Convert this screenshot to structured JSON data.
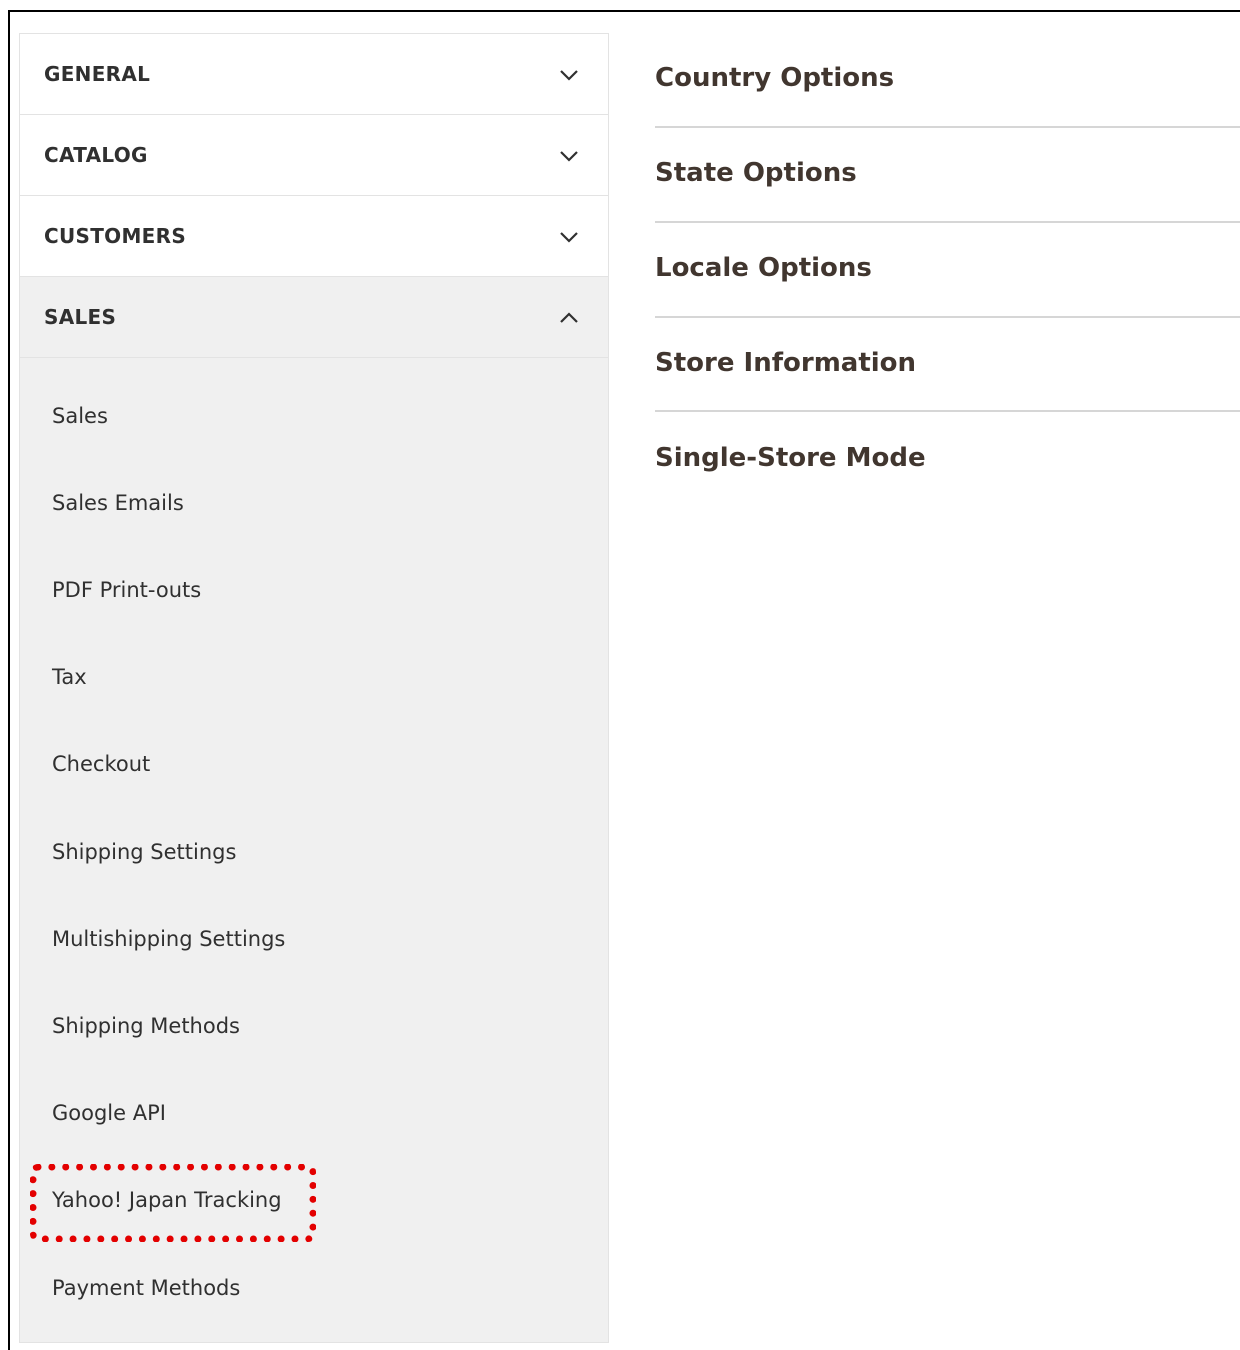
{
  "sidebar": {
    "sections": [
      {
        "label": "GENERAL",
        "state": "collapsed"
      },
      {
        "label": "CATALOG",
        "state": "collapsed"
      },
      {
        "label": "CUSTOMERS",
        "state": "collapsed"
      },
      {
        "label": "SALES",
        "state": "expanded"
      }
    ],
    "sales_items": [
      "Sales",
      "Sales Emails",
      "PDF Print-outs",
      "Tax",
      "Checkout",
      "Shipping Settings",
      "Multishipping Settings",
      "Shipping Methods",
      "Google API",
      "Yahoo! Japan Tracking",
      "Payment Methods"
    ],
    "highlighted_item": "Yahoo! Japan Tracking"
  },
  "main": {
    "groups": [
      "Country Options",
      "State Options",
      "Locale Options",
      "Store Information",
      "Single-Store Mode"
    ]
  },
  "colors": {
    "highlight": "#e30000",
    "sidebar_open_bg": "#f0f0f0",
    "text": "#303030",
    "group_title": "#41362f"
  },
  "icons": {
    "collapsed": "chevron-down-icon",
    "expanded": "chevron-up-icon"
  }
}
